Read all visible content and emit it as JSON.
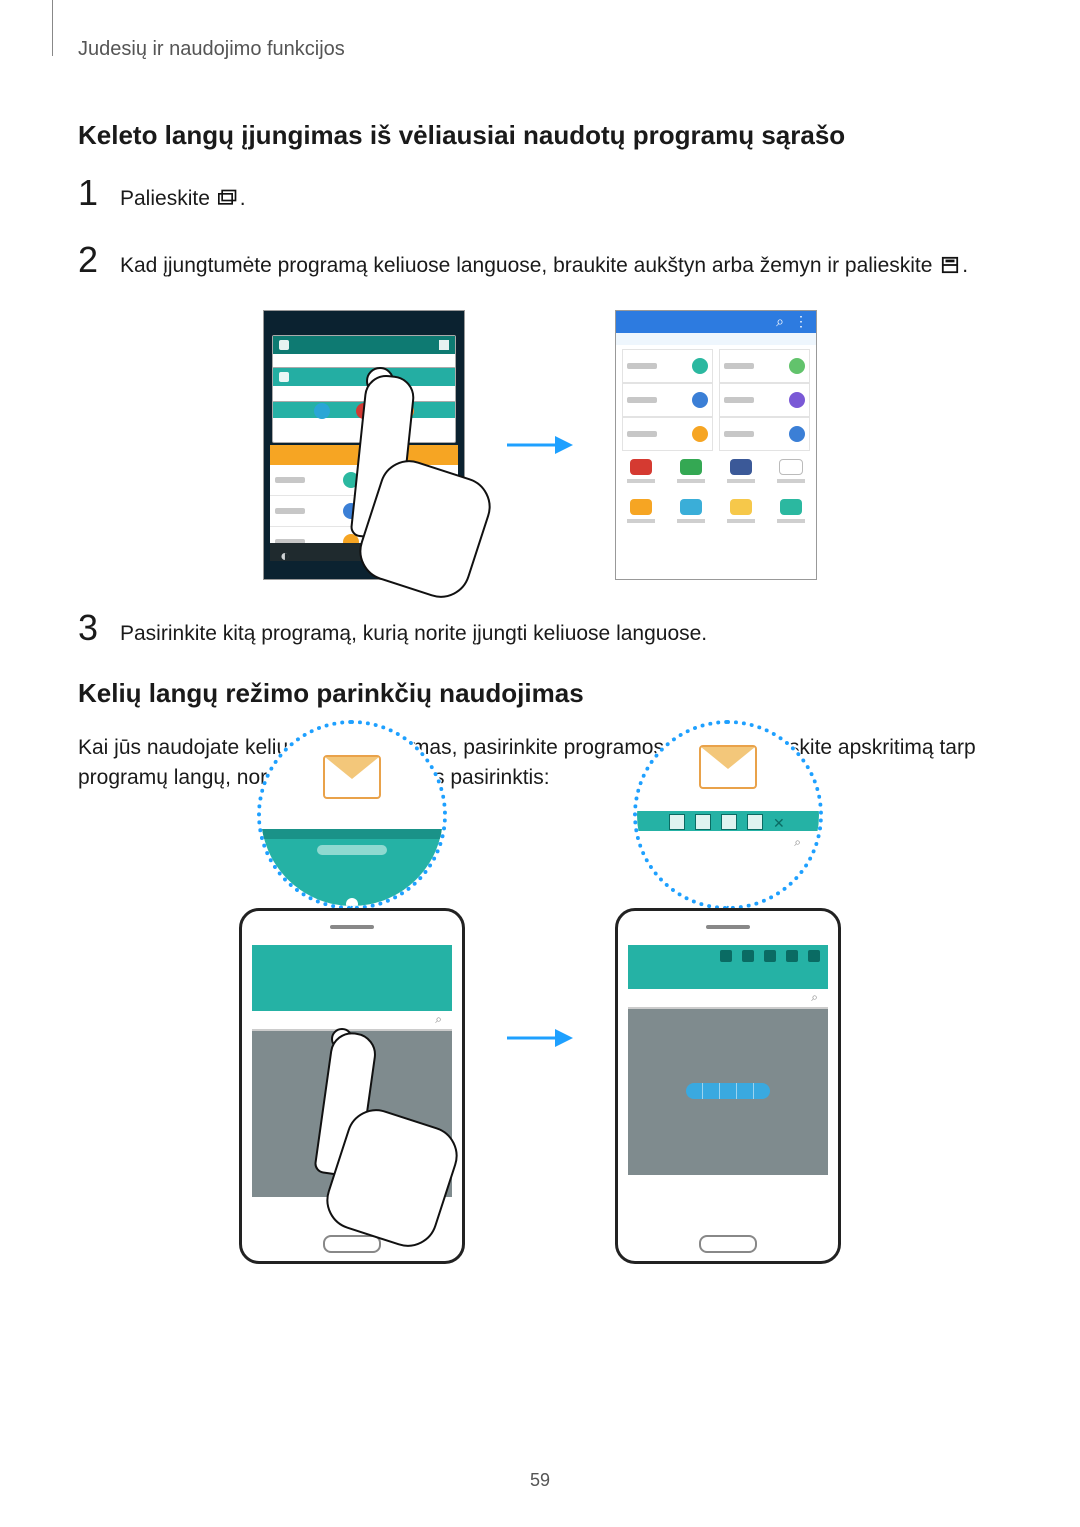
{
  "sectionLabel": "Judesių ir naudojimo funkcijos",
  "heading1": "Keleto langų įjungimas iš vėliausiai naudotų programų sąrašo",
  "steps": {
    "s1": {
      "num": "1",
      "text_a": "Palieskite ",
      "text_b": "."
    },
    "s2": {
      "num": "2",
      "text_a": "Kad įjungtumėte programą keliuose languose, braukite aukštyn arba žemyn ir palieskite ",
      "text_b": "."
    },
    "s3": {
      "num": "3",
      "text": "Pasirinkite kitą programą, kurią norite įjungti keliuose languose."
    }
  },
  "heading2": "Kelių langų režimo parinkčių naudojimas",
  "para2": "Kai jūs naudojate kelių langų programas, pasirinkite programos langą ir palieskite apskritimą tarp programų langų, norėdami pasiekti šias pasirinktis:",
  "pageNumber": "59",
  "fig1_right": {
    "topbar_search": "⌕",
    "topbar_more": "⋮"
  }
}
